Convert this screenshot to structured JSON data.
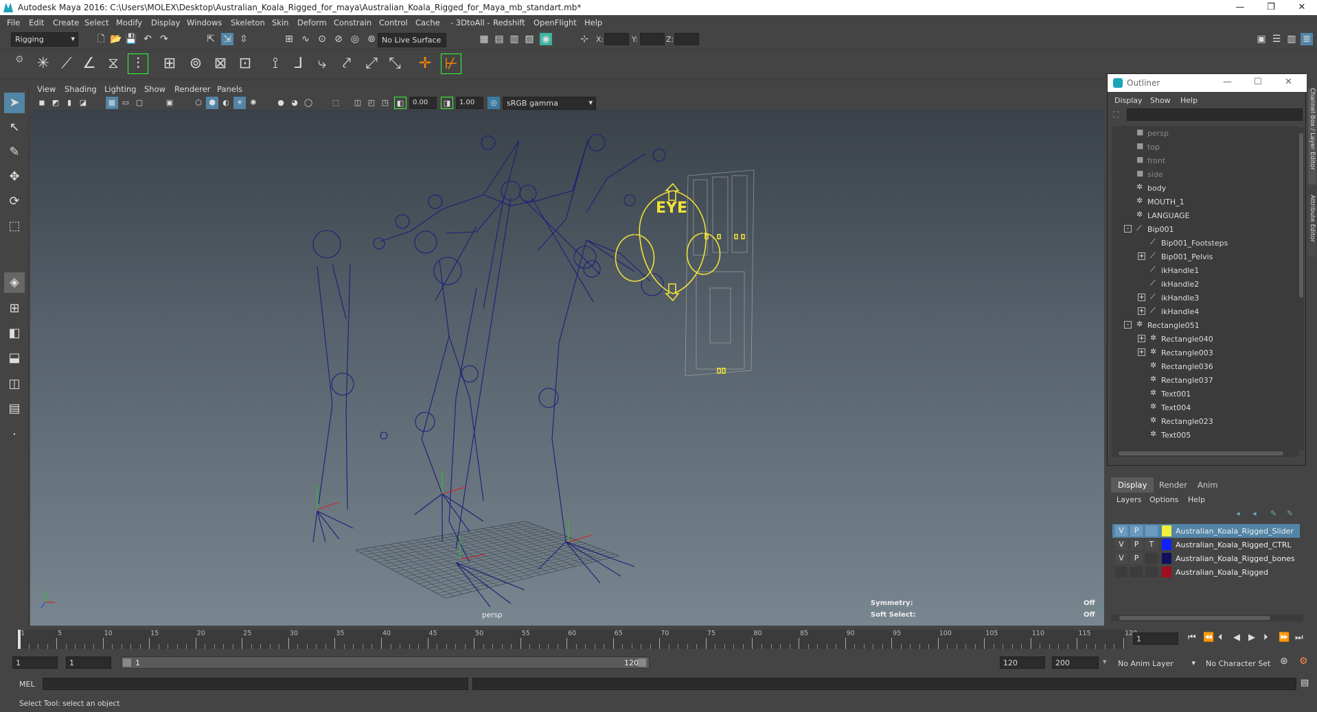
{
  "title": "Autodesk Maya 2016: C:\\Users\\MOLEX\\Desktop\\Australian_Koala_Rigged_for_maya\\Australian_Koala_Rigged_for_Maya_mb_standart.mb*",
  "menu": [
    "File",
    "Edit",
    "Create",
    "Select",
    "Modify",
    "Display",
    "Windows",
    "Skeleton",
    "Skin",
    "Deform",
    "Constrain",
    "Control",
    "Cache",
    "- 3DtoAll -",
    "Redshift",
    "OpenFlight",
    "Help"
  ],
  "toolbar": {
    "mode": "Rigging",
    "live_surface": "No Live Surface",
    "x_label": "X:",
    "y_label": "Y:",
    "z_label": "Z:"
  },
  "viewport": {
    "menu": [
      "View",
      "Shading",
      "Lighting",
      "Show",
      "Renderer",
      "Panels"
    ],
    "exposure": "0.00",
    "gamma": "1.00",
    "colorspace": "sRGB gamma",
    "camera_label": "persp",
    "symmetry_label": "Symmetry:",
    "symmetry_value": "Off",
    "softselect_label": "Soft Select:",
    "softselect_value": "Off",
    "eye_text": "EYE"
  },
  "outliner": {
    "title": "Outliner",
    "menu": [
      "Display",
      "Show",
      "Help"
    ],
    "items": [
      {
        "label": "persp",
        "depth": 0,
        "exp": "",
        "kind": "camera",
        "dim": true
      },
      {
        "label": "top",
        "depth": 0,
        "exp": "",
        "kind": "camera",
        "dim": true
      },
      {
        "label": "front",
        "depth": 0,
        "exp": "",
        "kind": "camera",
        "dim": true
      },
      {
        "label": "side",
        "depth": 0,
        "exp": "",
        "kind": "camera",
        "dim": true
      },
      {
        "label": "body",
        "depth": 0,
        "exp": "",
        "kind": "mesh",
        "dim": false
      },
      {
        "label": "MOUTH_1",
        "depth": 0,
        "exp": "",
        "kind": "mesh",
        "dim": false
      },
      {
        "label": "LANGUAGE",
        "depth": 0,
        "exp": "",
        "kind": "mesh",
        "dim": false
      },
      {
        "label": "Bip001",
        "depth": 0,
        "exp": "-",
        "kind": "joint",
        "dim": false
      },
      {
        "label": "Bip001_Footsteps",
        "depth": 1,
        "exp": "",
        "kind": "joint",
        "dim": false
      },
      {
        "label": "Bip001_Pelvis",
        "depth": 1,
        "exp": "+",
        "kind": "joint",
        "dim": false
      },
      {
        "label": "ikHandle1",
        "depth": 1,
        "exp": "",
        "kind": "joint",
        "dim": false
      },
      {
        "label": "ikHandle2",
        "depth": 1,
        "exp": "",
        "kind": "joint",
        "dim": false
      },
      {
        "label": "ikHandle3",
        "depth": 1,
        "exp": "+",
        "kind": "joint",
        "dim": false
      },
      {
        "label": "ikHandle4",
        "depth": 1,
        "exp": "+",
        "kind": "joint",
        "dim": false
      },
      {
        "label": "Rectangle051",
        "depth": 0,
        "exp": "-",
        "kind": "mesh",
        "dim": false
      },
      {
        "label": "Rectangle040",
        "depth": 1,
        "exp": "+",
        "kind": "mesh",
        "dim": false
      },
      {
        "label": "Rectangle003",
        "depth": 1,
        "exp": "+",
        "kind": "mesh",
        "dim": false
      },
      {
        "label": "Rectangle036",
        "depth": 1,
        "exp": "",
        "kind": "mesh",
        "dim": false
      },
      {
        "label": "Rectangle037",
        "depth": 1,
        "exp": "",
        "kind": "mesh",
        "dim": false
      },
      {
        "label": "Text001",
        "depth": 1,
        "exp": "",
        "kind": "mesh",
        "dim": false
      },
      {
        "label": "Text004",
        "depth": 1,
        "exp": "",
        "kind": "mesh",
        "dim": false
      },
      {
        "label": "Rectangle023",
        "depth": 1,
        "exp": "",
        "kind": "mesh",
        "dim": false
      },
      {
        "label": "Text005",
        "depth": 1,
        "exp": "",
        "kind": "mesh",
        "dim": false
      }
    ]
  },
  "layers": {
    "tabs": [
      "Display",
      "Render",
      "Anim"
    ],
    "menu": [
      "Layers",
      "Options",
      "Help"
    ],
    "rows": [
      {
        "v": "V",
        "p": "P",
        "t": "",
        "color": "#f2ef3a",
        "name": "Australian_Koala_Rigged_Slider",
        "selected": true
      },
      {
        "v": "V",
        "p": "P",
        "t": "T",
        "color": "#1020ff",
        "name": "Australian_Koala_Rigged_CTRL",
        "selected": false
      },
      {
        "v": "V",
        "p": "P",
        "t": "",
        "color": "#101060",
        "name": "Australian_Koala_Rigged_bones",
        "selected": false
      },
      {
        "v": "",
        "p": "",
        "t": "",
        "color": "#a01020",
        "name": "Australian_Koala_Rigged",
        "selected": false
      }
    ]
  },
  "timeline": {
    "ticks": [
      "1",
      "5",
      "10",
      "15",
      "20",
      "25",
      "30",
      "35",
      "40",
      "45",
      "50",
      "55",
      "60",
      "65",
      "70",
      "75",
      "80",
      "85",
      "90",
      "95",
      "100",
      "105",
      "110",
      "115",
      "120"
    ],
    "current_frame": "1"
  },
  "range": {
    "start": "1",
    "start2": "1",
    "inner_start": "1",
    "inner_end": "120",
    "end": "120",
    "end2": "200",
    "anim_layer": "No Anim Layer",
    "char_set": "No Character Set"
  },
  "cmd": {
    "label": "MEL"
  },
  "help": {
    "text": "Select Tool: select an object"
  },
  "sidetabs": [
    "Channel Box / Layer Editor",
    "Attribute Editor"
  ]
}
